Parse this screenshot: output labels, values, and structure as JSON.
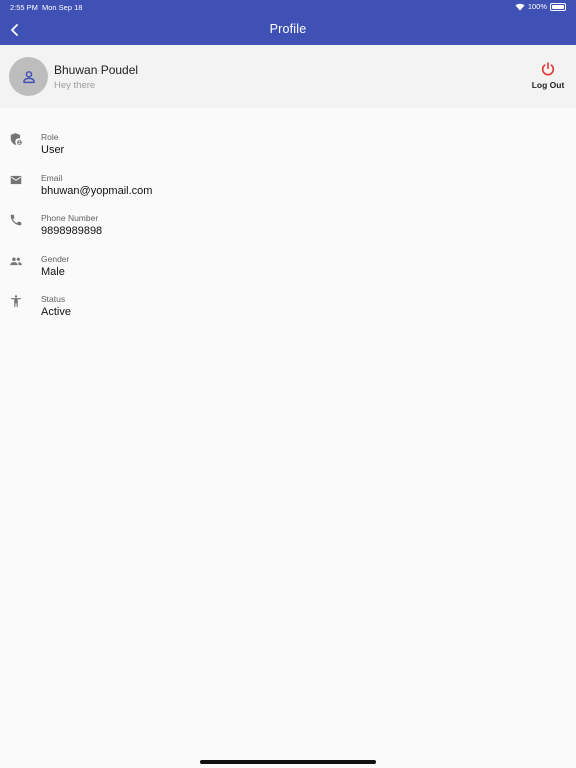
{
  "status_bar": {
    "time": "2:55 PM",
    "date": "Mon Sep 18",
    "battery": "100%"
  },
  "app_bar": {
    "title": "Profile"
  },
  "profile": {
    "name": "Bhuwan Poudel",
    "about": "Hey there",
    "logout_label": "Log Out"
  },
  "info": [
    {
      "icon": "role-shield-icon",
      "label": "Role",
      "value": "User"
    },
    {
      "icon": "email-icon",
      "label": "Email",
      "value": "bhuwan@yopmail.com"
    },
    {
      "icon": "phone-icon",
      "label": "Phone Number",
      "value": "9898989898"
    },
    {
      "icon": "people-icon",
      "label": "Gender",
      "value": "Male"
    },
    {
      "icon": "person-status-icon",
      "label": "Status",
      "value": "Active"
    }
  ],
  "colors": {
    "app_bar": "#3f51b5",
    "logout": "#e53935",
    "avatar_bg": "#bdbdbd",
    "avatar_icon": "#3f51b5",
    "icon_gray": "#757575"
  }
}
